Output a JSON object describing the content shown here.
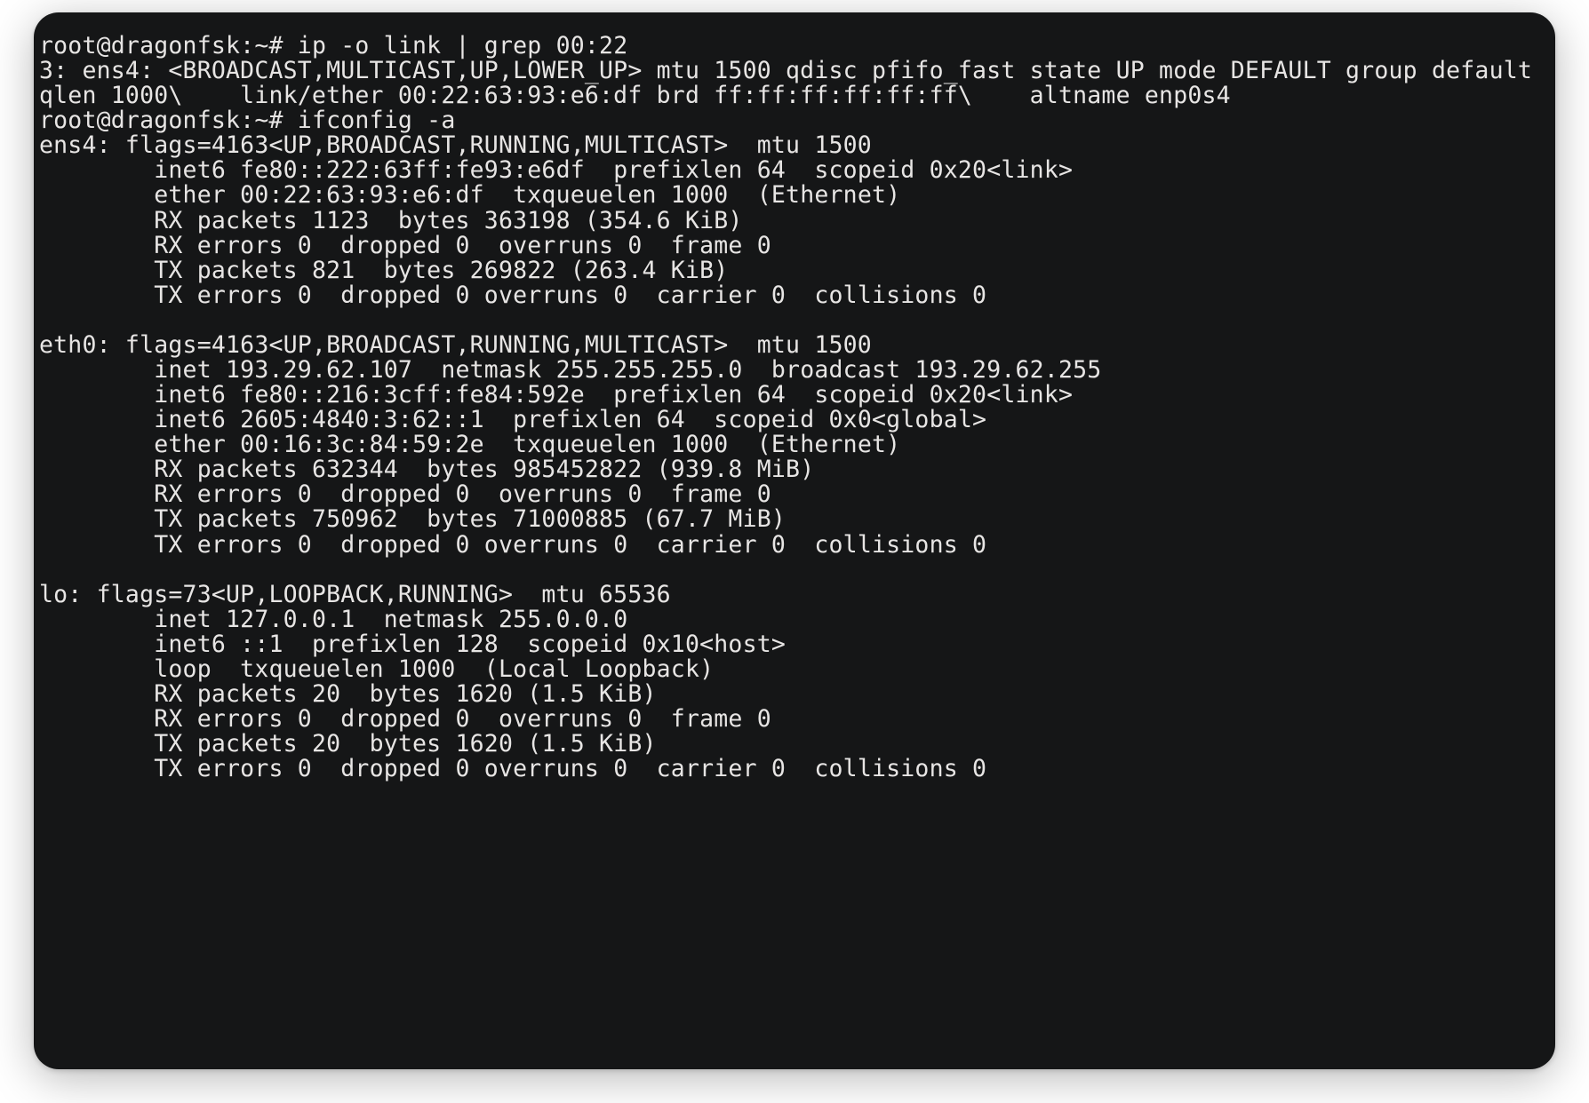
{
  "host": "root@dragonfsk",
  "cwd": "~",
  "prompt_suffix": "#",
  "commands": {
    "cmd1": "ip -o link | grep 00:22",
    "cmd1_output": "3: ens4: <BROADCAST,MULTICAST,UP,LOWER_UP> mtu 1500 qdisc pfifo_fast state UP mode DEFAULT group default qlen 1000\\    link/ether 00:22:63:93:e6:df brd ff:ff:ff:ff:ff:ff\\    altname enp0s4",
    "cmd2": "ifconfig -a"
  },
  "ifconfig": {
    "ens4": {
      "header": "ens4: flags=4163<UP,BROADCAST,RUNNING,MULTICAST>  mtu 1500",
      "l1": "        inet6 fe80::222:63ff:fe93:e6df  prefixlen 64  scopeid 0x20<link>",
      "l2": "        ether 00:22:63:93:e6:df  txqueuelen 1000  (Ethernet)",
      "l3": "        RX packets 1123  bytes 363198 (354.6 KiB)",
      "l4": "        RX errors 0  dropped 0  overruns 0  frame 0",
      "l5": "        TX packets 821  bytes 269822 (263.4 KiB)",
      "l6": "        TX errors 0  dropped 0 overruns 0  carrier 0  collisions 0"
    },
    "eth0": {
      "header": "eth0: flags=4163<UP,BROADCAST,RUNNING,MULTICAST>  mtu 1500",
      "l1": "        inet 193.29.62.107  netmask 255.255.255.0  broadcast 193.29.62.255",
      "l2": "        inet6 fe80::216:3cff:fe84:592e  prefixlen 64  scopeid 0x20<link>",
      "l3": "        inet6 2605:4840:3:62::1  prefixlen 64  scopeid 0x0<global>",
      "l4": "        ether 00:16:3c:84:59:2e  txqueuelen 1000  (Ethernet)",
      "l5": "        RX packets 632344  bytes 985452822 (939.8 MiB)",
      "l6": "        RX errors 0  dropped 0  overruns 0  frame 0",
      "l7": "        TX packets 750962  bytes 71000885 (67.7 MiB)",
      "l8": "        TX errors 0  dropped 0 overruns 0  carrier 0  collisions 0"
    },
    "lo": {
      "header": "lo: flags=73<UP,LOOPBACK,RUNNING>  mtu 65536",
      "l1": "        inet 127.0.0.1  netmask 255.0.0.0",
      "l2": "        inet6 ::1  prefixlen 128  scopeid 0x10<host>",
      "l3": "        loop  txqueuelen 1000  (Local Loopback)",
      "l4": "        RX packets 20  bytes 1620 (1.5 KiB)",
      "l5": "        RX errors 0  dropped 0  overruns 0  frame 0",
      "l6": "        TX packets 20  bytes 1620 (1.5 KiB)",
      "l7": "        TX errors 0  dropped 0 overruns 0  carrier 0  collisions 0"
    }
  }
}
